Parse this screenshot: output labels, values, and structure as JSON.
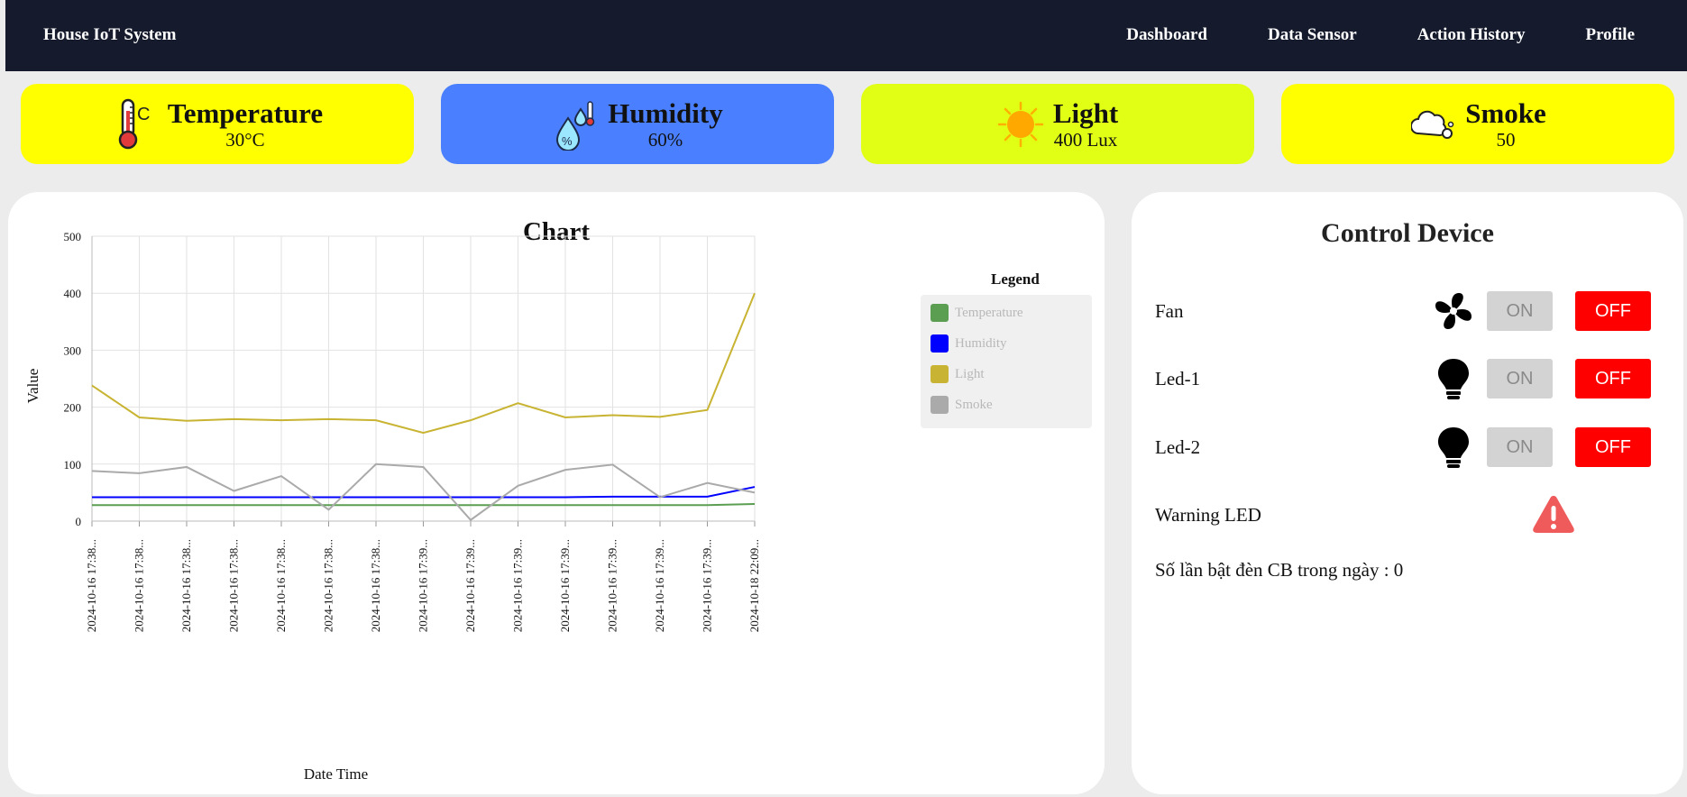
{
  "navbar": {
    "brand": "House IoT System",
    "links": [
      "Dashboard",
      "Data Sensor",
      "Action History",
      "Profile"
    ]
  },
  "cards": [
    {
      "title": "Temperature",
      "value": "30°C",
      "icon": "thermometer-icon",
      "color": "#ffff00"
    },
    {
      "title": "Humidity",
      "value": "60%",
      "icon": "humidity-drops-icon",
      "color": "#4a80ff"
    },
    {
      "title": "Light",
      "value": "400 Lux",
      "icon": "sun-icon",
      "color": "#e1ff14"
    },
    {
      "title": "Smoke",
      "value": "50",
      "icon": "smoke-cloud-icon",
      "color": "#ffff00"
    }
  ],
  "chart_data": {
    "type": "line",
    "title": "Chart",
    "xlabel": "Date Time",
    "ylabel": "Value",
    "ylim": [
      0,
      500
    ],
    "yticks": [
      0,
      100,
      200,
      300,
      400,
      500
    ],
    "grid": true,
    "legend_title": "Legend",
    "legend_placement": "right",
    "categories": [
      "2024-10-16 17:38...",
      "2024-10-16 17:38...",
      "2024-10-16 17:38...",
      "2024-10-16 17:38...",
      "2024-10-16 17:38...",
      "2024-10-16 17:38...",
      "2024-10-16 17:38...",
      "2024-10-16 17:39...",
      "2024-10-16 17:39...",
      "2024-10-16 17:39...",
      "2024-10-16 17:39...",
      "2024-10-16 17:39...",
      "2024-10-16 17:39...",
      "2024-10-16 17:39...",
      "2024-10-18 22:09..."
    ],
    "series": [
      {
        "name": "Temperature",
        "color": "#5b9e52",
        "values": [
          28,
          28,
          28,
          28,
          28,
          28,
          28,
          28,
          28,
          28,
          28,
          28,
          28,
          28,
          30
        ]
      },
      {
        "name": "Humidity",
        "color": "#0000ff",
        "values": [
          42,
          42,
          42,
          42,
          42,
          42,
          42,
          42,
          42,
          42,
          42,
          43,
          43,
          43,
          60
        ]
      },
      {
        "name": "Light",
        "color": "#c8b432",
        "values": [
          238,
          182,
          176,
          179,
          177,
          179,
          177,
          155,
          177,
          207,
          182,
          186,
          183,
          195,
          400
        ]
      },
      {
        "name": "Smoke",
        "color": "#aaaaaa",
        "values": [
          88,
          84,
          95,
          53,
          79,
          20,
          100,
          95,
          2,
          62,
          90,
          99,
          42,
          67,
          50
        ]
      }
    ]
  },
  "control": {
    "title": "Control Device",
    "devices": [
      {
        "label": "Fan",
        "icon": "fan-icon",
        "on_label": "ON",
        "off_label": "OFF"
      },
      {
        "label": "Led-1",
        "icon": "lightbulb-icon",
        "on_label": "ON",
        "off_label": "OFF"
      },
      {
        "label": "Led-2",
        "icon": "lightbulb-icon",
        "on_label": "ON",
        "off_label": "OFF"
      }
    ],
    "warning_label": "Warning LED",
    "warning_icon": "warning-triangle-icon",
    "count_text": "Số lần bật đèn CB trong ngày : 0"
  }
}
